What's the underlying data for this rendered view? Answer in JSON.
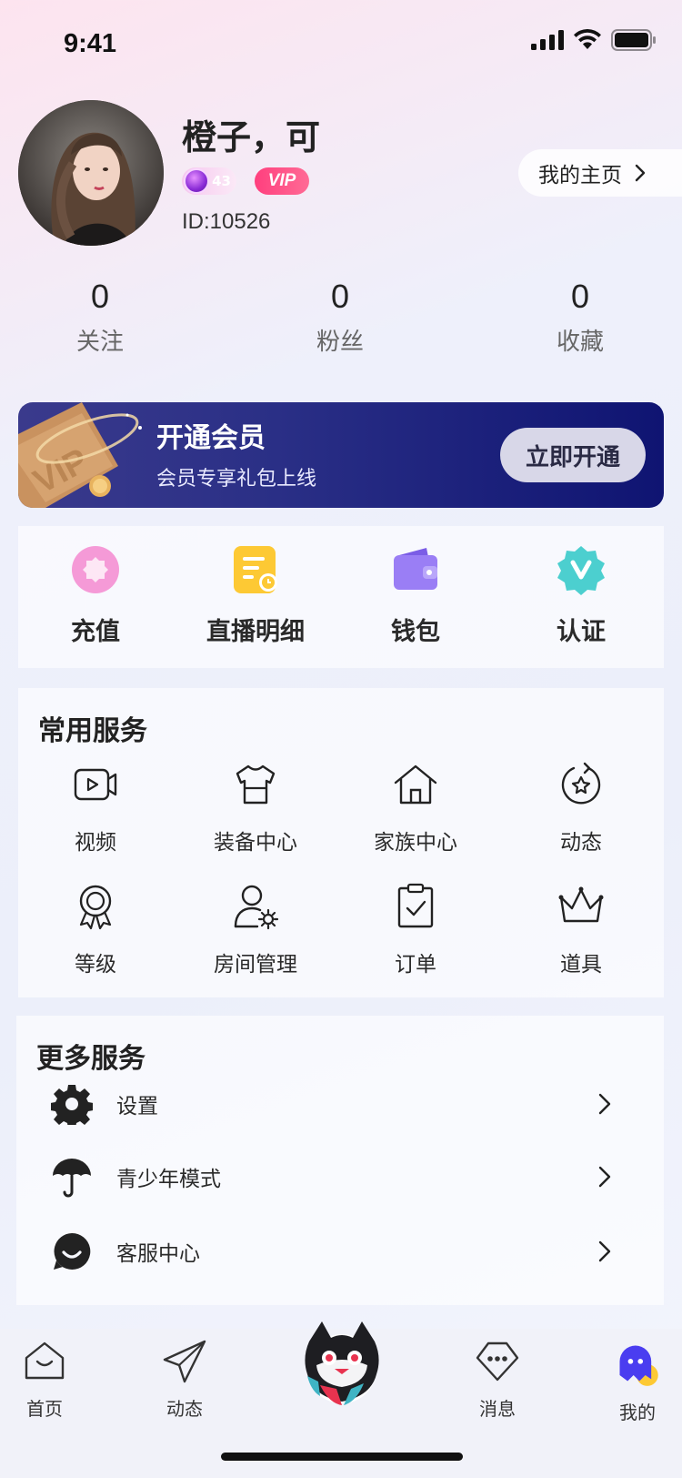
{
  "status_bar": {
    "time": "9:41"
  },
  "profile": {
    "nickname": "橙子，可",
    "level": "43",
    "vip_label": "VIP",
    "id_text": "ID:10526",
    "homepage_label": "我的主页"
  },
  "stats": [
    {
      "value": "0",
      "label": "关注"
    },
    {
      "value": "0",
      "label": "粉丝"
    },
    {
      "value": "0",
      "label": "收藏"
    }
  ],
  "vip_banner": {
    "title": "开通会员",
    "subtitle": "会员专享礼包上线",
    "button": "立即开通",
    "image_text": "VIP"
  },
  "quick_actions": [
    {
      "label": "充值",
      "icon": "recharge-icon"
    },
    {
      "label": "直播明细",
      "icon": "live-detail-icon"
    },
    {
      "label": "钱包",
      "icon": "wallet-icon"
    },
    {
      "label": "认证",
      "icon": "verify-icon"
    }
  ],
  "common_services": {
    "title": "常用服务",
    "items": [
      {
        "label": "视频",
        "icon": "video-icon"
      },
      {
        "label": "装备中心",
        "icon": "shirt-icon"
      },
      {
        "label": "家族中心",
        "icon": "house-icon"
      },
      {
        "label": "动态",
        "icon": "star-refresh-icon"
      },
      {
        "label": "等级",
        "icon": "medal-icon"
      },
      {
        "label": "房间管理",
        "icon": "user-settings-icon"
      },
      {
        "label": "订单",
        "icon": "clipboard-check-icon"
      },
      {
        "label": "道具",
        "icon": "crown-icon"
      }
    ]
  },
  "more_services": {
    "title": "更多服务",
    "items": [
      {
        "label": "设置",
        "icon": "gear-icon"
      },
      {
        "label": "青少年模式",
        "icon": "umbrella-icon"
      },
      {
        "label": "客服中心",
        "icon": "smile-chat-icon"
      }
    ]
  },
  "tab_bar": {
    "items": [
      {
        "label": "首页",
        "icon": "home-icon"
      },
      {
        "label": "动态",
        "icon": "paper-plane-icon"
      },
      {
        "label": "",
        "icon": "mascot-icon"
      },
      {
        "label": "消息",
        "icon": "message-icon"
      },
      {
        "label": "我的",
        "icon": "profile-ghost-icon"
      }
    ],
    "active_index": 4
  },
  "colors": {
    "vip_pink": "#ff4f86",
    "banner_start": "#3a3a8c",
    "banner_end": "#0f1472",
    "recharge_pink": "#f59ad7",
    "live_yellow": "#fdc934",
    "wallet_purple": "#9a7ef5",
    "verify_teal": "#4ccfcf",
    "active_tab_blue": "#4a3df0"
  }
}
